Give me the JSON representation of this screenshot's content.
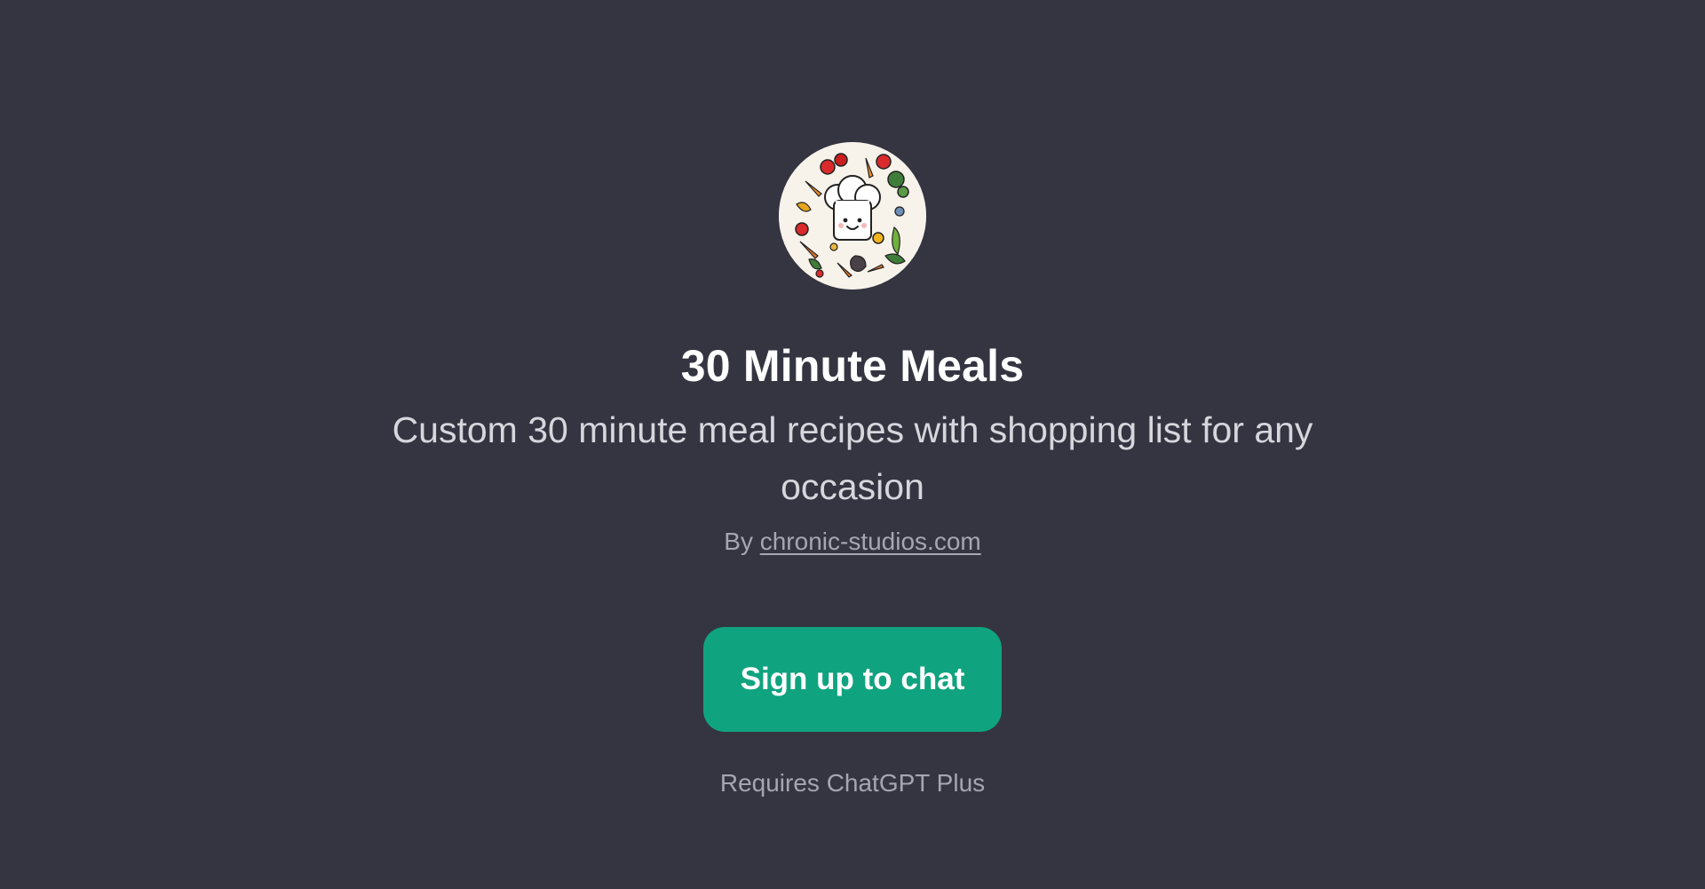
{
  "gpt": {
    "avatar_icon": "chef-hat-vegetables-icon",
    "title": "30 Minute Meals",
    "description": "Custom 30 minute meal recipes with shopping list for any occasion",
    "byline_prefix": "By",
    "author_link": "chronic-studios.com"
  },
  "cta": {
    "label": "Sign up to chat"
  },
  "footer": {
    "requirement": "Requires ChatGPT Plus"
  },
  "colors": {
    "background": "#343541",
    "accent": "#10a37f",
    "title": "#ffffff",
    "muted": "#a6a6b2"
  }
}
